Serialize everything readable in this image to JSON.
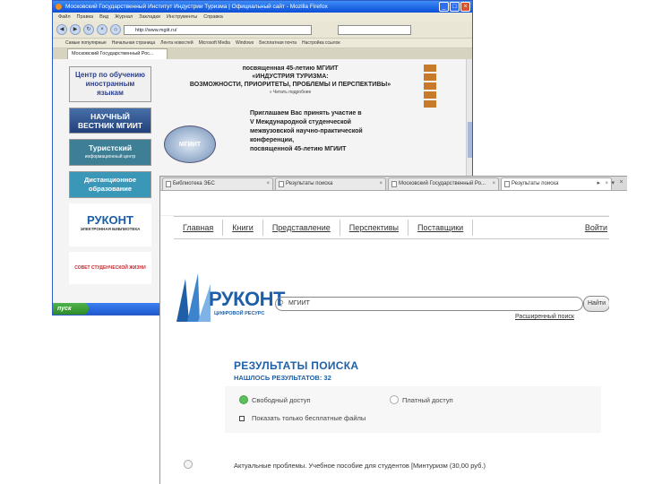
{
  "back_window": {
    "title": "Московский Государственный Институт Индустрии Туризма | Официальный сайт - Mozilla Firefox",
    "menu": [
      "Файл",
      "Правка",
      "Вид",
      "Журнал",
      "Закладки",
      "Инструменты",
      "Справка"
    ],
    "url": "http://www.mgiit.ru/",
    "bookmarks": [
      "Самые популярные",
      "Начальная страница",
      "Лента новостей",
      "Microsoft Media",
      "Windows",
      "Бесплатная почта",
      "Настройка ссылок"
    ],
    "tab_label": "Московский Государственный Рос...",
    "banners": {
      "languages": "Центр по обучению иностранным языкам",
      "vestnik": "НАУЧНЫЙ ВЕСТНИК МГИИТ",
      "tourist": "Туристский",
      "tourist_sub": "информационный центр",
      "distance": "Дистанционное образование",
      "rucont": "РУКОНТ",
      "rucont_sub": "ЭЛЕКТРОННАЯ БИБЛИОТЕКА",
      "council": "СОВЕТ СТУДЕНЧЕСКОЙ ЖИЗНИ"
    },
    "center": {
      "line1": "посвященная 45-летию МГИИТ",
      "line2": "«ИНДУСТРИЯ ТУРИЗМА:",
      "line3": "ВОЗМОЖНОСТИ, ПРИОРИТЕТЫ, ПРОБЛЕМЫ И ПЕРСПЕКТИВЫ»",
      "read_more": "» Читать подробнее",
      "invite": "Приглашаем Вас принять участие в",
      "conf1": "V Международной студенческой",
      "conf2": "межвузовской научно-практической",
      "conf3": "конференции,",
      "conf4": "посвященной 45-летию МГИИТ",
      "logo": "МГИИТ"
    },
    "start": "пуск"
  },
  "front_window": {
    "tabs": [
      "Библиотека ЭБС",
      "Результаты поиска",
      "Московский Государственный Ро...",
      "Результаты поиска"
    ],
    "nav": [
      "Главная",
      "Книги",
      "Представление",
      "Перспективы",
      "Поставщики"
    ],
    "login": "Войти",
    "brand": "РУКОНТ",
    "brand_tag": "ЦИФРОВОЙ РЕСУРС",
    "search_value": "МГИИТ",
    "search_button": "Найти",
    "advanced": "Расширенный поиск",
    "results_title": "РЕЗУЛЬТАТЫ ПОИСКА",
    "found": "НАШЛОСЬ РЕЗУЛЬТАТОВ: 32",
    "filter_all": "Свободный доступ",
    "filter_closed": "Платный доступ",
    "free_only": "Показать только бесплатные файлы",
    "first_result": "Актуальные проблемы. Учебное пособие для студентов [Минтуризм (30,00 руб.)"
  }
}
